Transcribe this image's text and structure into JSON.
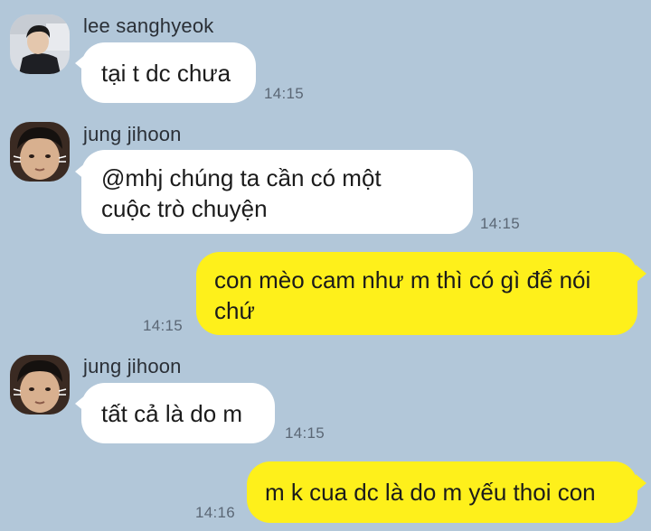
{
  "messages": [
    {
      "sender": "lee sanghyeok",
      "text": "tại t dc chưa",
      "time": "14:15"
    },
    {
      "sender": "jung jihoon",
      "text_line1": "@mhj chúng ta cần có một",
      "text_line2": "cuộc trò chuyện",
      "time": "14:15"
    },
    {
      "text_line1": "con mèo cam như m thì có gì để nói",
      "text_line2": "chứ",
      "time": "14:15"
    },
    {
      "sender": "jung jihoon",
      "text": "tất cả là do m",
      "time": "14:15"
    },
    {
      "text": "m k cua dc là do m yếu thoi con",
      "time": "14:16"
    }
  ],
  "colors": {
    "background": "#b2c7d9",
    "incoming_bubble": "#ffffff",
    "outgoing_bubble": "#fef01b"
  }
}
